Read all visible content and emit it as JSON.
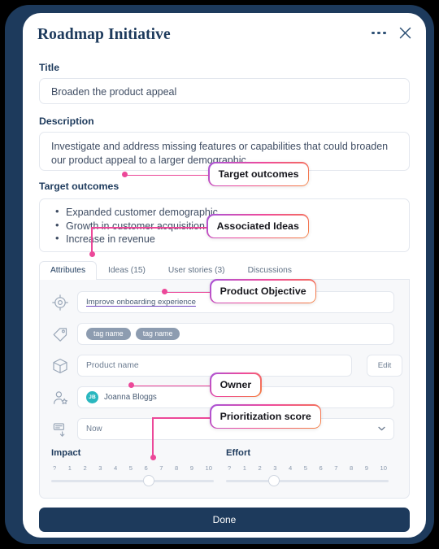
{
  "header": {
    "title": "Roadmap Initiative",
    "more_icon": "more-horizontal-icon",
    "close_icon": "close-icon"
  },
  "fields": {
    "title_label": "Title",
    "title_value": "Broaden the product appeal",
    "description_label": "Description",
    "description_value": "Investigate and address missing features or capabilities that could broaden our product appeal to a larger demographic.",
    "outcomes_label": "Target outcomes",
    "outcomes": [
      "Expanded customer demographic",
      "Growth in customer acquisition",
      "Increase in revenue"
    ]
  },
  "tabs": [
    {
      "label": "Attributes",
      "active": true
    },
    {
      "label": "Ideas (15)",
      "active": false
    },
    {
      "label": "User stories (3)",
      "active": false
    },
    {
      "label": "Discussions",
      "active": false
    }
  ],
  "attributes": {
    "objective": {
      "icon": "target-icon",
      "value": "Improve onboarding experience"
    },
    "tags": {
      "icon": "tag-icon",
      "items": [
        "tag name",
        "tag name"
      ]
    },
    "product": {
      "icon": "box-icon",
      "placeholder": "Product name",
      "edit_label": "Edit"
    },
    "owner": {
      "icon": "person-star-icon",
      "avatar_initials": "JB",
      "avatar_color": "#2ab7bf",
      "name": "Joanna Bloggs"
    },
    "priority": {
      "icon": "prioritize-icon",
      "value": "Now",
      "caret_icon": "chevron-down-icon"
    }
  },
  "sliders": {
    "ticks": [
      "?",
      "1",
      "2",
      "3",
      "4",
      "5",
      "6",
      "7",
      "8",
      "9",
      "10"
    ],
    "impact": {
      "label": "Impact",
      "value": 6.5,
      "percent": 61
    },
    "effort": {
      "label": "Effort",
      "value": 3,
      "percent": 28
    }
  },
  "footer": {
    "done_label": "Done"
  },
  "annotations": [
    {
      "label": "Target outcomes"
    },
    {
      "label": "Associated Ideas"
    },
    {
      "label": "Product Objective"
    },
    {
      "label": "Owner"
    },
    {
      "label": "Prioritization score"
    }
  ],
  "colors": {
    "navy": "#1d3a5c",
    "accent_pink": "#ec4899",
    "panel_bg": "#f7f8fa",
    "border": "#e3e7ee"
  }
}
